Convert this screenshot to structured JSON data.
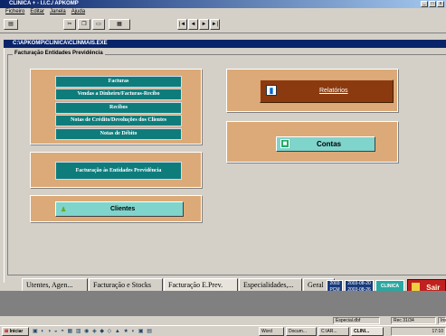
{
  "app": {
    "title": "CLINICA + - I.I.C./ APKOMP"
  },
  "menu": [
    "Ficheiro",
    "Editar",
    "Janela",
    "Ajuda"
  ],
  "child_window": {
    "title": "C:\\APKOMP\\CLINICA\\CLINMAIS.EXE"
  },
  "group_label": "Facturação Entidades Previdência",
  "buttons": {
    "facturas": "Facturas",
    "vendas": "Vendas a Dinheiro/Facturas-Recibo",
    "recibos": "Recibos",
    "notas_credito": "Notas de Crédito/Devoluções dos Clientes",
    "notas_debito": "Notas de Débito",
    "fact_entidades": "Facturação às Entidades Previdência",
    "clientes": "Clientes",
    "relatorios": "Relatórios",
    "contas": "Contas"
  },
  "tabs": [
    "Utentes, Agen...",
    "Facturação e Stocks",
    "Facturação E.Prev.",
    "Especialidades,...",
    "Geral"
  ],
  "active_tab": 2,
  "badge": {
    "year": "2003",
    "date": "2003-08-20",
    "sub": "PCM",
    "date2": "2003-08-26",
    "logo": "CLINICA"
  },
  "sair": "Sair",
  "status": {
    "left": "Especial.dbf",
    "right": "Rec 31/34",
    "extra": "Ins"
  },
  "taskbar": {
    "start": "Iniciar",
    "items": [
      "Word",
      "Docum...",
      "C:\\AR...",
      "CLINI..."
    ],
    "clock": "17:10"
  },
  "nav_buttons": [
    "|◄",
    "◄",
    "►",
    "►|"
  ],
  "colors": {
    "panel": "#dcaa78",
    "teal": "#0f7c7c",
    "brown": "#8b3a0f",
    "light_teal": "#7fd4cc"
  }
}
